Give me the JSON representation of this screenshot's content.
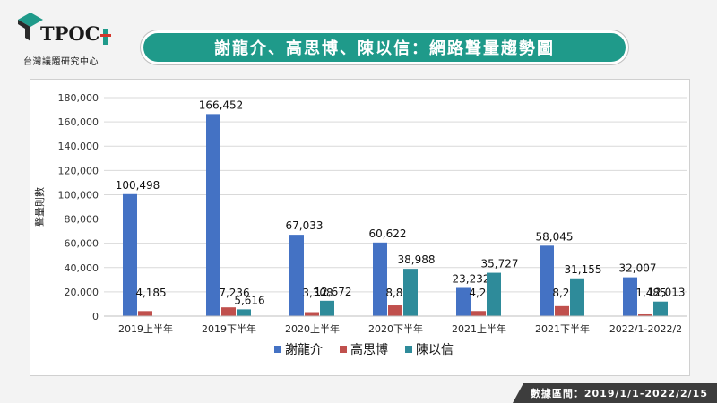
{
  "header": {
    "logo_text": "TPOC",
    "org_name": "台灣議題研究中心",
    "title": "謝龍介、高思博、陳以信：網路聲量趨勢圖"
  },
  "footer": {
    "date_range": "數據區間：2019/1/1-2022/2/15"
  },
  "colors": {
    "series_1": "#4472c4",
    "series_2": "#c0504d",
    "series_3": "#2e8b9a",
    "title_bg": "#1f9a8a",
    "footer_bg": "#3d3d3d"
  },
  "chart_data": {
    "type": "bar",
    "title": "",
    "xlabel": "",
    "ylabel": "聲量則數",
    "ylim": [
      0,
      180000
    ],
    "yticks": [
      "0",
      "20,000",
      "40,000",
      "60,000",
      "80,000",
      "100,000",
      "120,000",
      "140,000",
      "160,000",
      "180,000"
    ],
    "grid": true,
    "legend_position": "bottom",
    "categories": [
      "2019上半年",
      "2019下半年",
      "2020上半年",
      "2020下半年",
      "2021上半年",
      "2021下半年",
      "2022/1-2022/2"
    ],
    "series": [
      {
        "name": "謝龍介",
        "values": [
          100498,
          166452,
          67033,
          60622,
          23232,
          58045,
          32007
        ],
        "labels": [
          "100,498",
          "166,452",
          "67,033",
          "60,622",
          "23,232",
          "58,045",
          "32,007"
        ]
      },
      {
        "name": "高思博",
        "values": [
          4185,
          7236,
          3308,
          8832,
          4231,
          8243,
          1485
        ],
        "labels": [
          "4,185",
          "7,236",
          "3,308",
          "8,832",
          "4,231",
          "8,243",
          "1,485"
        ]
      },
      {
        "name": "陳以信",
        "values": [
          0,
          5616,
          12672,
          38988,
          35727,
          31155,
          12013
        ],
        "labels": [
          "",
          "5,616",
          "12,672",
          "38,988",
          "35,727",
          "31,155",
          "12,013"
        ]
      }
    ]
  }
}
